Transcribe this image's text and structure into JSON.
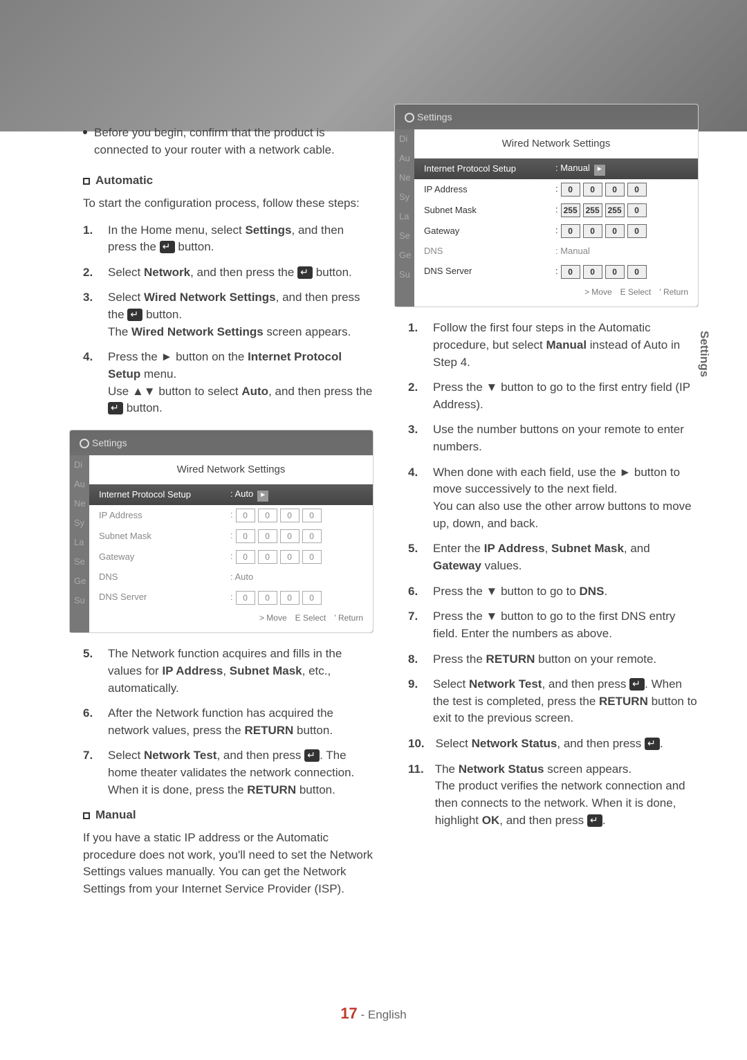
{
  "sideTab": "Settings",
  "pageNumber": "17",
  "pageLang": "English",
  "preNote": "Before you begin, confirm that the product is connected to your router with a network cable.",
  "sec1": {
    "heading": "Automatic",
    "intro": "To start the configuration process, follow these steps:",
    "steps": [
      "In the Home menu, select <b>Settings</b>, and then press the {E} button.",
      "Select <b>Network</b>, and then press the {E} button.",
      "Select <b>Wired Network Settings</b>, and then press the {E} button.<br>The <b>Wired Network Settings</b> screen appears.",
      "Press the ► button on the <b>Internet Protocol Setup</b> menu.<br>Use ▲▼ button to select <b>Auto</b>, and then press the {E} button."
    ],
    "stepsAfter": [
      "The Network function acquires and fills in the values for <b>IP Address</b>, <b>Subnet Mask</b>, etc., automatically.",
      "After the Network function has acquired the network values, press the <b>RETURN</b> button.",
      "Select <b>Network Test</b>, and then press {E}. The home theater validates the network connection. When it is done, press the <b>RETURN</b> button."
    ]
  },
  "sec2": {
    "heading": "Manual",
    "intro": "If you have a static IP address or the Automatic procedure does not work, you'll need to set the Network Settings values manually. You can get the Network Settings from your Internet Service Provider (ISP)."
  },
  "rightSteps": [
    "Follow the first four steps in the Automatic procedure, but select <b>Manual</b> instead of Auto in Step 4.",
    "Press the ▼ button to go to the first entry field (IP Address).",
    "Use the number buttons on your remote to enter numbers.",
    "When done with each field, use the ► button to move successively to the next field.<br>You can also use the other arrow buttons to move up, down, and back.",
    "Enter the <b>IP Address</b>, <b>Subnet Mask</b>, and <b>Gateway</b> values.",
    "Press the ▼ button to go to <b>DNS</b>.",
    "Press the ▼ button to go to the first DNS entry field. Enter the numbers as above.",
    "Press the <b>RETURN</b> button on your remote.",
    "Select <b>Network Test</b>, and then press {E}. When the test is completed, press the <b>RETURN</b> button to exit to the previous screen.",
    "Select <b>Network Status</b>, and then press {E}.",
    "The <b>Network Status</b> screen appears.<br>The product verifies the network connection and then connects to the network. When it is done, highlight <b>OK</b>, and then press {E}."
  ],
  "screenshotA": {
    "header": "Settings",
    "title": "Wired Network Settings",
    "side": [
      "Di",
      "Au",
      "Ne",
      "Sy",
      "La",
      "Se",
      "Ge",
      "Su"
    ],
    "rows": [
      {
        "label": "Internet Protocol Setup",
        "value": ": Auto",
        "active": true
      },
      {
        "label": "IP Address",
        "oct": [
          "0",
          "0",
          "0",
          "0"
        ],
        "dim": true
      },
      {
        "label": "Subnet Mask",
        "oct": [
          "0",
          "0",
          "0",
          "0"
        ],
        "dim": true
      },
      {
        "label": "Gateway",
        "oct": [
          "0",
          "0",
          "0",
          "0"
        ],
        "dim": true
      },
      {
        "label": "DNS",
        "value": ": Auto"
      },
      {
        "label": "DNS Server",
        "oct": [
          "0",
          "0",
          "0",
          "0"
        ],
        "dim": true
      }
    ],
    "footer": [
      "> Move",
      "E Select",
      "' Return"
    ]
  },
  "screenshotB": {
    "header": "Settings",
    "title": "Wired Network Settings",
    "side": [
      "Di",
      "Au",
      "Ne",
      "Sy",
      "La",
      "Se",
      "Ge",
      "Su"
    ],
    "rows": [
      {
        "label": "Internet Protocol Setup",
        "value": ": Manual",
        "active": true
      },
      {
        "label": "IP Address",
        "oct": [
          "0",
          "0",
          "0",
          "0"
        ],
        "enabled": true
      },
      {
        "label": "Subnet Mask",
        "oct": [
          "255",
          "255",
          "255",
          "0"
        ],
        "enabled": true
      },
      {
        "label": "Gateway",
        "oct": [
          "0",
          "0",
          "0",
          "0"
        ],
        "enabled": true
      },
      {
        "label": "DNS",
        "value": ": Manual"
      },
      {
        "label": "DNS Server",
        "oct": [
          "0",
          "0",
          "0",
          "0"
        ],
        "enabled": true
      }
    ],
    "footer": [
      "> Move",
      "E Select",
      "' Return"
    ]
  }
}
